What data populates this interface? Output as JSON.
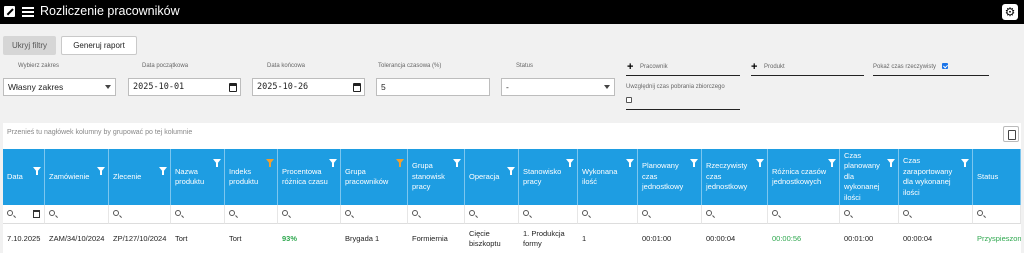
{
  "app": {
    "title": "Rozliczenie pracowników"
  },
  "toolbar": {
    "hide_filters": "Ukryj filtry",
    "generate_report": "Generuj raport"
  },
  "filters": {
    "range_label": "Wybierz zakres",
    "range_value": "Własny zakres",
    "start_label": "Data początkowa",
    "start_value": "2025-10-01",
    "end_label": "Data końcowa",
    "end_value": "2025-10-26",
    "tolerance_label": "Tolerancja czasowa (%)",
    "tolerance_value": "5",
    "status_label": "Status",
    "status_value": "-",
    "employee_label": "Pracownik",
    "product_label": "Produkt",
    "collect_label": "Uwzględnij czas pobrania zbiorczego",
    "collect_checked": false,
    "realtime_label": "Pokaż czas rzeczywisty",
    "realtime_checked": true
  },
  "grid": {
    "group_hint": "Przenieś tu nagłówek kolumny by grupować po tej kolumnie",
    "columns": [
      "Data",
      "Zamówienie",
      "Zlecenie",
      "Nazwa produktu",
      "Indeks produktu",
      "Procentowa różnica czasu",
      "Grupa pracowników",
      "Grupa stanowisk pracy",
      "Operacja",
      "Stanowisko pracy",
      "Wykonana ilość",
      "Planowany czas jednostkowy",
      "Rzeczywisty czas jednostkowy",
      "Różnica czasów jednostkowych",
      "Czas planowany dla wykonanej ilości",
      "Czas zaraportowany dla wykonanej ilości",
      "Status"
    ],
    "rows": [
      [
        "7.10.2025",
        "ZAM/34/10/2024",
        "ZP/127/10/2024",
        "Tort",
        "Tort",
        "93%",
        "Brygada 1",
        "Formiernia",
        "Cięcie biszkoptu",
        "1. Produkcja formy",
        "1",
        "00:01:00",
        "00:00:04",
        "00:00:56",
        "00:01:00",
        "00:00:04",
        "Przyspieszony"
      ]
    ]
  },
  "colors": {
    "header": "#1e9de2",
    "accent_green": "#2fa84f",
    "funnel_active": "#f0a030"
  },
  "icons": [
    "app-icon",
    "hamburger-icon",
    "gear-icon",
    "calendar-icon",
    "plus-icon",
    "funnel-icon",
    "search-icon",
    "export-icon"
  ]
}
